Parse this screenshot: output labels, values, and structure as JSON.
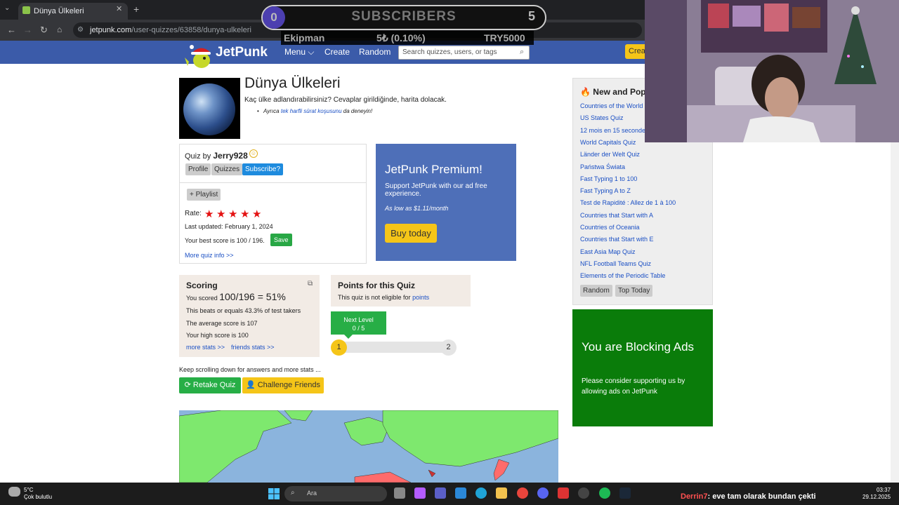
{
  "browser": {
    "tab_title": "Dünya Ülkeleri",
    "tab_close": "✕",
    "new_tab": "+",
    "url_host": "jetpunk.com",
    "url_path": "/user-quizzes/63858/dunya-ulkeleri"
  },
  "overlay": {
    "subscribers_current": "0",
    "subscribers_label": "SUBSCRIBERS",
    "subscribers_goal": "5",
    "ticker_name": "Ekipman",
    "ticker_change": "5₺ (0.10%)",
    "ticker_value": "TRY5000"
  },
  "header": {
    "logo": "JetPunk",
    "nav": [
      "Menu",
      "Create",
      "Random"
    ],
    "search_placeholder": "Search quizzes, users, or tags",
    "create_button": "Create"
  },
  "quiz": {
    "title": "Dünya Ülkeleri",
    "description": "Kaç ülke adlandırabilirsiniz? Cevaplar girildiğinde, harita dolacak.",
    "alt_prefix": "Ayrıca",
    "alt_link": "tek harfli sürat koşusunu",
    "alt_suffix": "da deneyin!",
    "by_label": "Quiz by",
    "author": "Jerry928",
    "profile_btn": "Profile",
    "quizzes_btn": "Quizzes",
    "subscribe_btn": "Subscribe?",
    "playlist_btn": "+ Playlist",
    "rate_label": "Rate:",
    "rating_stars": 5,
    "last_updated": "Last updated: February 1, 2024",
    "best_score": "Your best score is 100 / 196.",
    "save_btn": "Save",
    "more_info": "More quiz info >>"
  },
  "premium": {
    "title": "JetPunk Premium!",
    "text": "Support JetPunk with our ad free experience.",
    "price": "As low as $1.11/month",
    "button": "Buy today"
  },
  "scoring": {
    "title": "Scoring",
    "scored_prefix": "You scored",
    "scored_value": "100/196 = 51%",
    "beats": "This beats or equals 43.3% of test takers",
    "average": "The average score is 107",
    "high": "Your high score is 100",
    "more_stats": "more stats >>",
    "friends_stats": "friends stats >>"
  },
  "points": {
    "title": "Points for this Quiz",
    "text": "This quiz is not eligible for",
    "link": "points",
    "next_level": "Next Level",
    "progress_text": "0 / 5",
    "progress_fraction": 0,
    "level_current": "1",
    "level_next": "2"
  },
  "actions": {
    "keep_scrolling": "Keep scrolling down for answers and more stats ...",
    "retake": "Retake Quiz",
    "challenge": "Challenge Friends"
  },
  "sidebar": {
    "title": "New and Popular",
    "items": [
      "Countries of the World",
      "US States Quiz",
      "12 mois en 15 secondes",
      "World Capitals Quiz",
      "Länder der Welt Quiz",
      "Państwa Świata",
      "Fast Typing 1 to 100",
      "Fast Typing A to Z",
      "Test de Rapidité : Allez de 1 à 100",
      "Countries that Start with A",
      "Countries of Oceania",
      "Countries that Start with E",
      "East Asia Map Quiz",
      "NFL Football Teams Quiz",
      "Elements of the Periodic Table"
    ],
    "random_btn": "Random",
    "top_btn": "Top Today"
  },
  "block": {
    "title": "You are Blocking Ads",
    "text": "Please consider supporting us by allowing ads on JetPunk"
  },
  "taskbar": {
    "temp": "5°C",
    "weather": "Çok bulutlu",
    "search": "Ara",
    "chat_user": "Derrin7",
    "chat_msg": ": eve tam olarak bundan çekti",
    "time": "03:37",
    "date": "29.12.2025"
  },
  "colors": {
    "jetpunk_blue": "#3b5ba9",
    "green": "#27ae46",
    "yellow": "#f5c518"
  }
}
